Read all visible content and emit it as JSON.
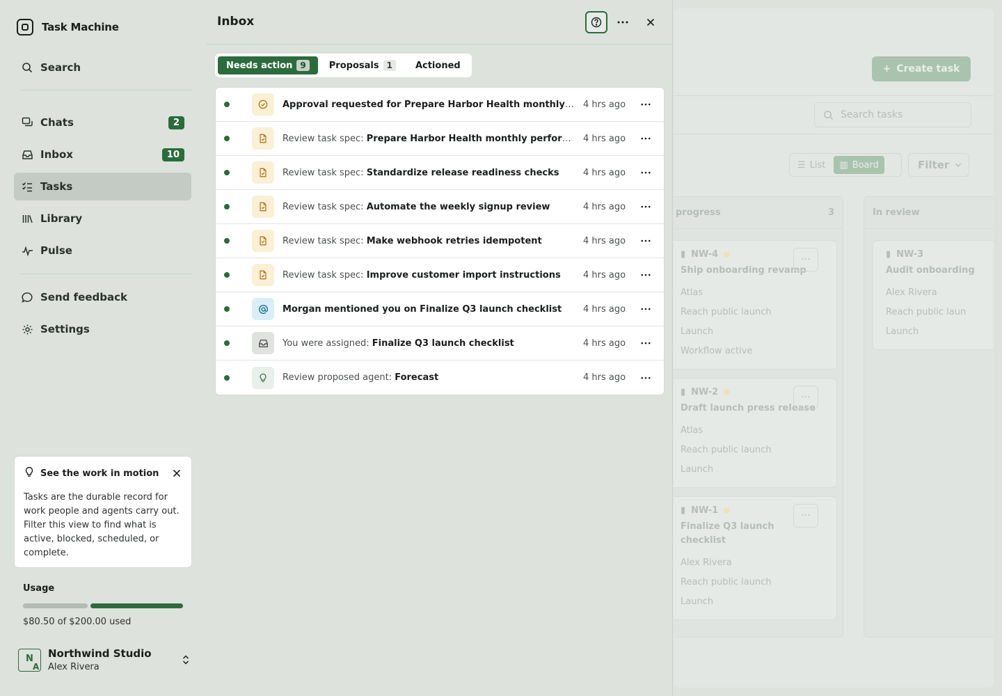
{
  "app": {
    "name": "Task Machine"
  },
  "sidebar": {
    "search_label": "Search",
    "items": [
      {
        "label": "Chats",
        "badge": "2",
        "icon": "chats-icon"
      },
      {
        "label": "Inbox",
        "badge": "10",
        "icon": "inbox-icon"
      },
      {
        "label": "Tasks",
        "badge": "",
        "icon": "tasks-icon",
        "active": true
      },
      {
        "label": "Library",
        "badge": "",
        "icon": "library-icon"
      },
      {
        "label": "Pulse",
        "badge": "",
        "icon": "pulse-icon"
      }
    ],
    "feedback_label": "Send feedback",
    "settings_label": "Settings",
    "tip": {
      "title": "See the work in motion",
      "body": "Tasks are the durable record for work people and agents carry out. Filter this view to find what is active, blocked, scheduled, or complete."
    },
    "usage": {
      "title": "Usage",
      "text": "$80.50 of $200.00 used",
      "used": 80.5,
      "limit": 200
    },
    "org": {
      "initial_1": "N",
      "initial_2": "A",
      "name": "Northwind Studio",
      "user": "Alex Rivera"
    }
  },
  "inbox": {
    "title": "Inbox",
    "tabs": [
      {
        "label": "Needs action",
        "count": "9",
        "active": true
      },
      {
        "label": "Proposals",
        "count": "1",
        "active": false
      },
      {
        "label": "Actioned",
        "count": "",
        "active": false
      }
    ],
    "items": [
      {
        "prefix": "",
        "subject": "Approval requested for Prepare Harbor Health monthly performance report",
        "time": "4 hrs ago",
        "icon": "approval-check-icon",
        "kind": "approve"
      },
      {
        "prefix": "Review task spec: ",
        "subject": "Prepare Harbor Health monthly performance report",
        "time": "4 hrs ago",
        "icon": "document-check-icon",
        "kind": "spec"
      },
      {
        "prefix": "Review task spec: ",
        "subject": "Standardize release readiness checks",
        "time": "4 hrs ago",
        "icon": "document-check-icon",
        "kind": "spec"
      },
      {
        "prefix": "Review task spec: ",
        "subject": "Automate the weekly signup review",
        "time": "4 hrs ago",
        "icon": "document-check-icon",
        "kind": "spec"
      },
      {
        "prefix": "Review task spec: ",
        "subject": "Make webhook retries idempotent",
        "time": "4 hrs ago",
        "icon": "document-check-icon",
        "kind": "spec"
      },
      {
        "prefix": "Review task spec: ",
        "subject": "Improve customer import instructions",
        "time": "4 hrs ago",
        "icon": "document-check-icon",
        "kind": "spec"
      },
      {
        "prefix": "",
        "subject": "Morgan mentioned you on Finalize Q3 launch checklist",
        "time": "4 hrs ago",
        "icon": "at-mention-icon",
        "kind": "mention"
      },
      {
        "prefix": "You were assigned: ",
        "subject": "Finalize Q3 launch checklist",
        "time": "4 hrs ago",
        "icon": "inbox-tray-icon",
        "kind": "assign"
      },
      {
        "prefix": "Review proposed agent: ",
        "subject": "Forecast",
        "time": "4 hrs ago",
        "icon": "lightbulb-icon",
        "kind": "agent"
      }
    ]
  },
  "board": {
    "create_label": "Create task",
    "search_placeholder": "Search tasks",
    "view_list": "List",
    "view_board": "Board",
    "filter_label": "Filter",
    "columns": [
      {
        "title": "progress",
        "count": "3",
        "cards": [
          {
            "id": "NW-4",
            "title": "Ship onboarding revamp",
            "meta": [
              "Atlas",
              "Reach public launch",
              "Launch",
              "Workflow active"
            ]
          },
          {
            "id": "NW-2",
            "title": "Draft launch press release",
            "meta": [
              "Atlas",
              "Reach public launch",
              "Launch"
            ]
          },
          {
            "id": "NW-1",
            "title": "Finalize Q3 launch checklist",
            "meta": [
              "Alex Rivera",
              "Reach public launch",
              "Launch"
            ]
          }
        ]
      },
      {
        "title": "In review",
        "count": "",
        "cards": [
          {
            "id": "NW-3",
            "title": "Audit onboarding",
            "meta": [
              "Alex Rivera",
              "Reach public laun",
              "Launch"
            ]
          }
        ]
      }
    ]
  },
  "colors": {
    "accent": "#2c6b3c",
    "panel": "#dde2dd",
    "spec_icon_bg": "#fbefd5",
    "mention_icon_bg": "#d9eef6"
  }
}
